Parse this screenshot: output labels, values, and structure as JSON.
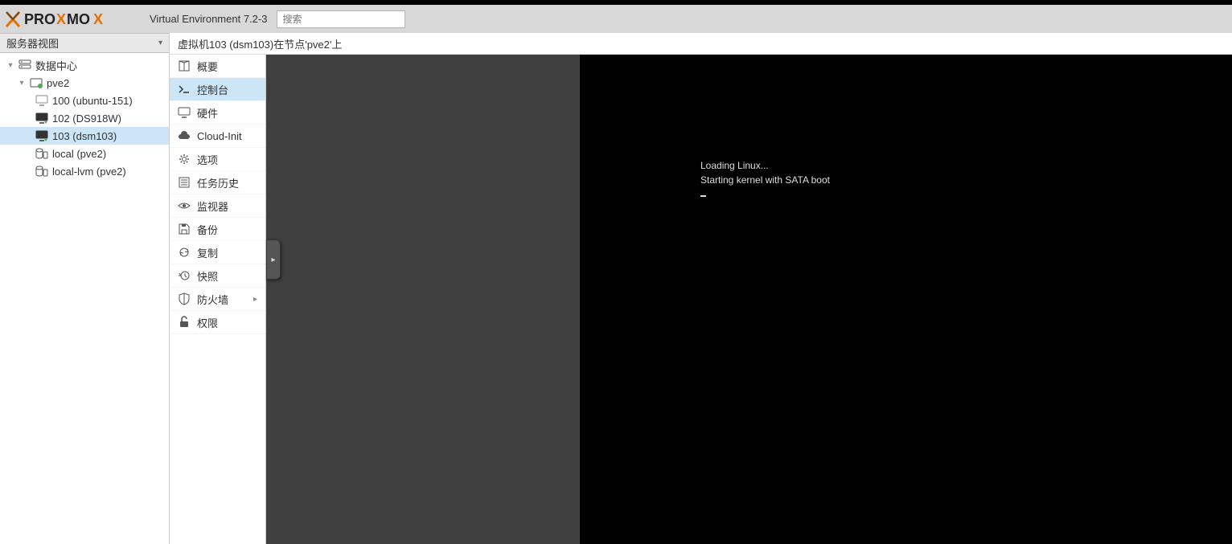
{
  "header": {
    "product": "PROXMOX",
    "ve_label": "Virtual Environment 7.2-3",
    "search_placeholder": "搜索"
  },
  "sidebar": {
    "view_label": "服务器视图",
    "tree": [
      {
        "id": "datacenter",
        "label": "数据中心",
        "indent": 0,
        "icon": "server-icon",
        "expanded": true
      },
      {
        "id": "pve2",
        "label": "pve2",
        "indent": 1,
        "icon": "node-icon",
        "expanded": true
      },
      {
        "id": "vm100",
        "label": "100 (ubuntu-151)",
        "indent": 2,
        "icon": "monitor-off-icon"
      },
      {
        "id": "vm102",
        "label": "102 (DS918W)",
        "indent": 2,
        "icon": "monitor-on-icon"
      },
      {
        "id": "vm103",
        "label": "103 (dsm103)",
        "indent": 2,
        "icon": "monitor-on-icon",
        "selected": true
      },
      {
        "id": "local",
        "label": "local (pve2)",
        "indent": 2,
        "icon": "storage-icon"
      },
      {
        "id": "locallvm",
        "label": "local-lvm (pve2)",
        "indent": 2,
        "icon": "storage-icon"
      }
    ]
  },
  "breadcrumb": "虚拟机103 (dsm103)在节点'pve2'上",
  "menu": [
    {
      "id": "summary",
      "label": "概要",
      "icon": "book-icon"
    },
    {
      "id": "console",
      "label": "控制台",
      "icon": "terminal-icon",
      "selected": true
    },
    {
      "id": "hardware",
      "label": "硬件",
      "icon": "monitor-icon"
    },
    {
      "id": "cloudinit",
      "label": "Cloud-Init",
      "icon": "cloud-icon"
    },
    {
      "id": "options",
      "label": "选项",
      "icon": "gear-icon"
    },
    {
      "id": "taskhistory",
      "label": "任务历史",
      "icon": "list-icon"
    },
    {
      "id": "monitor",
      "label": "监视器",
      "icon": "eye-icon"
    },
    {
      "id": "backup",
      "label": "备份",
      "icon": "save-icon"
    },
    {
      "id": "replication",
      "label": "复制",
      "icon": "sync-icon"
    },
    {
      "id": "snapshot",
      "label": "快照",
      "icon": "history-icon"
    },
    {
      "id": "firewall",
      "label": "防火墙",
      "icon": "shield-icon",
      "has_sub": true
    },
    {
      "id": "permissions",
      "label": "权限",
      "icon": "unlock-icon"
    }
  ],
  "console": {
    "line1": "Loading Linux...",
    "line2": "Starting kernel with SATA boot"
  }
}
